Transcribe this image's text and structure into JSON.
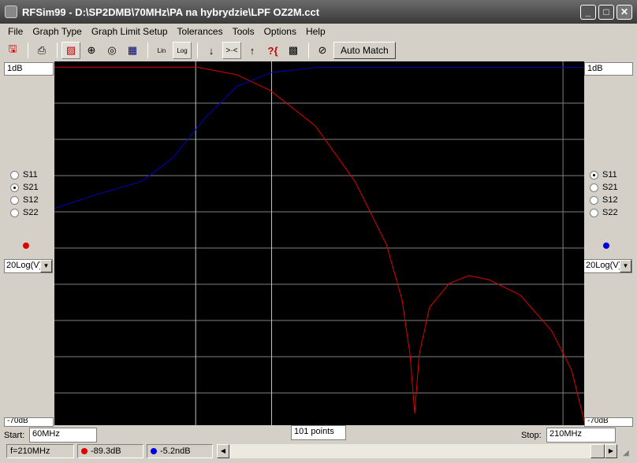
{
  "window": {
    "title": "RFSim99 - D:\\SP2DMB\\70MHz\\PA na hybrydzie\\LPF OZ2M.cct",
    "minimize": "_",
    "maximize": "□",
    "close": "✕"
  },
  "menu": [
    "File",
    "Graph Type",
    "Graph Limit Setup",
    "Tolerances",
    "Tools",
    "Options",
    "Help"
  ],
  "toolbar": {
    "icons": [
      "save-icon",
      "print-icon",
      "graph-rect-icon",
      "smith-chart-icon",
      "polar-chart-icon",
      "table-icon",
      "lin-scale-icon",
      "log-scale-icon",
      "arrow-down-icon",
      "zoom-in-icon",
      "arrow-up-icon",
      "help-icon",
      "component-icon",
      "tune-icon"
    ],
    "lin": "Lin",
    "log": "Log",
    "auto_match": "Auto Match"
  },
  "left_panel": {
    "top_scale": "1dB",
    "bottom_scale": "-70dB",
    "params": [
      "S11",
      "S21",
      "S12",
      "S22"
    ],
    "selected": "S21",
    "color": "#e00000",
    "mode": "20Log(V)"
  },
  "right_panel": {
    "top_scale": "1dB",
    "bottom_scale": "-70dB",
    "params": [
      "S11",
      "S21",
      "S12",
      "S22"
    ],
    "selected": "S11",
    "color": "#0000e0",
    "mode": "20Log(V)"
  },
  "sweep": {
    "start_label": "Start:",
    "start": "60MHz",
    "points": "101 points",
    "stop_label": "Stop:",
    "stop": "210MHz"
  },
  "status": {
    "freq": "f=210MHz",
    "left_value": "-89.3dB",
    "right_value": "-5.2ndB"
  },
  "chart_data": {
    "type": "line",
    "xlim": [
      60,
      210
    ],
    "ylim": [
      -70,
      1
    ],
    "x_unit": "MHz",
    "y_unit": "dB",
    "grid": true,
    "series": [
      {
        "param": "S21",
        "color": "#e00000",
        "points": [
          [
            60,
            -0.1
          ],
          [
            100.4,
            -0.1
          ],
          [
            111.6,
            -1.6
          ],
          [
            121.2,
            -4.7
          ],
          [
            133.9,
            -11.6
          ],
          [
            145.1,
            -22.4
          ],
          [
            154,
            -34.7
          ],
          [
            158.4,
            -45.4
          ],
          [
            160.7,
            -56.2
          ],
          [
            162,
            -67.7
          ],
          [
            163.3,
            -56.2
          ],
          [
            166.2,
            -47
          ],
          [
            171.8,
            -42.3
          ],
          [
            177.4,
            -40.8
          ],
          [
            183,
            -41.6
          ],
          [
            191.9,
            -44.6
          ],
          [
            200.8,
            -51.6
          ],
          [
            206.4,
            -59.2
          ],
          [
            210,
            -69.2
          ]
        ]
      },
      {
        "param": "S11",
        "color": "#0000c0",
        "points": [
          [
            60,
            -27.7
          ],
          [
            71.4,
            -25.1
          ],
          [
            84.8,
            -22.4
          ],
          [
            93.7,
            -17.7
          ],
          [
            102.6,
            -10.1
          ],
          [
            111.6,
            -3.9
          ],
          [
            121.2,
            -1.2
          ],
          [
            133.9,
            -0.2
          ],
          [
            210,
            -0.2
          ]
        ]
      }
    ]
  }
}
